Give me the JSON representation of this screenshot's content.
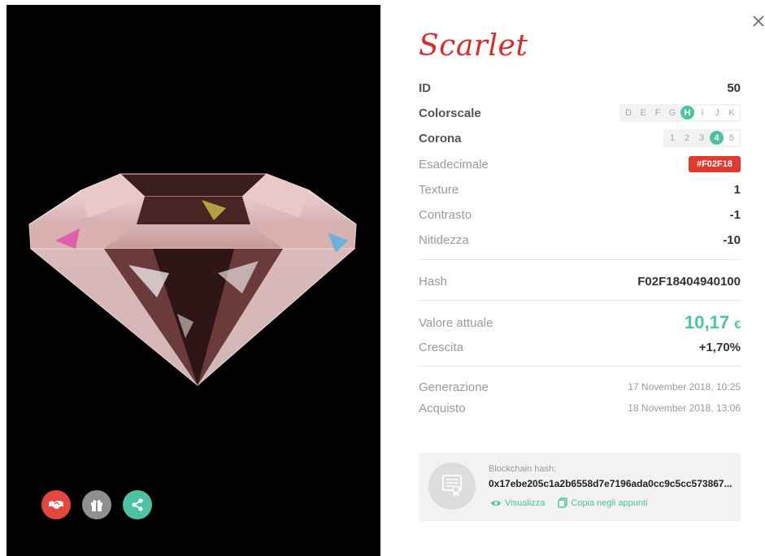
{
  "title": "Scarlet",
  "details": {
    "id": {
      "label": "ID",
      "value": "50"
    },
    "colorscale": {
      "label": "Colorscale",
      "options": [
        "D",
        "E",
        "F",
        "G",
        "H",
        "I",
        "J",
        "K"
      ],
      "selected": "H"
    },
    "corona": {
      "label": "Corona",
      "options": [
        "1",
        "2",
        "3",
        "4",
        "5"
      ],
      "selected": "4"
    },
    "esadecimale": {
      "label": "Esadecimale",
      "value": "#F02F18"
    },
    "texture": {
      "label": "Texture",
      "value": "1"
    },
    "contrasto": {
      "label": "Contrasto",
      "value": "-1"
    },
    "nitidezza": {
      "label": "Nitidezza",
      "value": "-10"
    }
  },
  "hash": {
    "label": "Hash",
    "value": "F02F18404940100"
  },
  "valuation": {
    "current": {
      "label": "Valore attuale",
      "value": "10,17",
      "currency": "€"
    },
    "growth": {
      "label": "Crescita",
      "value": "+1,70%"
    }
  },
  "dates": {
    "generazione": {
      "label": "Generazione",
      "value": "17 November 2018, 10:25"
    },
    "acquisto": {
      "label": "Acquisto",
      "value": "18 November 2018, 13:06"
    }
  },
  "blockchain": {
    "label": "Blockchain hash:",
    "hash": "0x17ebe205c1a2b6558d7e7196ada0cc9c5cc573867...",
    "view_label": "Visualizza",
    "copy_label": "Copia negli appunti"
  },
  "actions": [
    {
      "name": "handshake-icon",
      "color": "#e5463d"
    },
    {
      "name": "gift-icon",
      "color": "#8f8f8f"
    },
    {
      "name": "share-icon",
      "color": "#4dc2a2"
    }
  ],
  "colors": {
    "accent": "#4dc2a2",
    "title": "#d82b2b",
    "hex_badge": "#e03a2f"
  }
}
